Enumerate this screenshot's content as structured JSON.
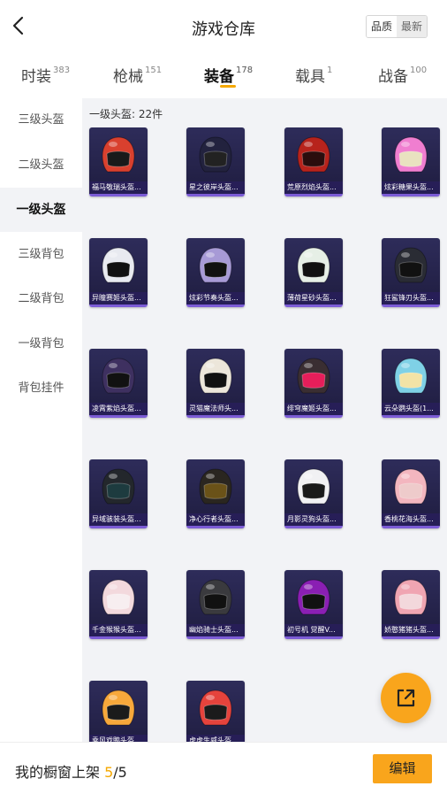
{
  "header": {
    "title": "游戏仓库",
    "sort": {
      "quality": "品质",
      "newest": "最新"
    }
  },
  "tabs": [
    {
      "label": "时装",
      "count": "383"
    },
    {
      "label": "枪械",
      "count": "151"
    },
    {
      "label": "装备",
      "count": "178",
      "active": true
    },
    {
      "label": "载具",
      "count": "1"
    },
    {
      "label": "战备",
      "count": "100"
    }
  ],
  "sidebar": {
    "items": [
      {
        "label": "三级头盔"
      },
      {
        "label": "二级头盔"
      },
      {
        "label": "一级头盔",
        "active": true
      },
      {
        "label": "三级背包"
      },
      {
        "label": "二级背包"
      },
      {
        "label": "一级背包"
      },
      {
        "label": "背包挂件"
      }
    ]
  },
  "content": {
    "count_label": "一级头盔: 22件",
    "items": [
      {
        "label": "福马敬瑞头盔...",
        "color": "#d9402e",
        "visor": "#1a1a1a"
      },
      {
        "label": "星之彼岸头盔...",
        "color": "#22223e",
        "visor": "#222"
      },
      {
        "label": "荒原烈焰头盔...",
        "color": "#b7231c",
        "visor": "#2a0d0d"
      },
      {
        "label": "炫彩糖果头盔...",
        "color": "#f07ed0",
        "visor": "#e9e2c0"
      },
      {
        "label": "异瞳赛姬头盔...",
        "color": "#e8eaf0",
        "visor": "#111"
      },
      {
        "label": "炫彩节奏头盔...",
        "color": "#a79ad6",
        "visor": "#111"
      },
      {
        "label": "薄荷星砂头盔...",
        "color": "#e6efe6",
        "visor": "#111"
      },
      {
        "label": "狂鲨锋刃头盔...",
        "color": "#2a2c34",
        "visor": "#111"
      },
      {
        "label": "凌霄紫焰头盔...",
        "color": "#3e3060",
        "visor": "#111"
      },
      {
        "label": "灵猫魔法师头...",
        "color": "#ece6da",
        "visor": "#111"
      },
      {
        "label": "绯穹魔姬头盔...",
        "color": "#3a2e32",
        "visor": "#e61e5a"
      },
      {
        "label": "云朵鹦头盔(1...",
        "color": "#7fd1e6",
        "visor": "#f3e3a6"
      },
      {
        "label": "异域骇装头盔...",
        "color": "#23272c",
        "visor": "#1d3b3f"
      },
      {
        "label": "净心行者头盔...",
        "color": "#2a2620",
        "visor": "#6a5218"
      },
      {
        "label": "月影灵狗头盔...",
        "color": "#f1f1f3",
        "visor": "#1a1a1a"
      },
      {
        "label": "香桃花海头盔...",
        "color": "#f3b6bf",
        "visor": "#eecbcb"
      },
      {
        "label": "千金猴猴头盔...",
        "color": "#f3d9dd",
        "visor": "#f7eef0"
      },
      {
        "label": "幽焰骑士头盔...",
        "color": "#3a3a3e",
        "visor": "#111"
      },
      {
        "label": "初号机 觉醒V...",
        "color": "#8a1fb3",
        "visor": "#111"
      },
      {
        "label": "娇憨猪猪头盔...",
        "color": "#f0a5b2",
        "visor": "#f3d8dc"
      },
      {
        "label": "乘风戏鸭头盔...",
        "color": "#f7a83b",
        "visor": "#1b1b1b"
      },
      {
        "label": "虎虎生威头盔...",
        "color": "#e5433c",
        "visor": "#1b1b1b"
      }
    ]
  },
  "fab": {
    "icon": "share-external-icon"
  },
  "bottom": {
    "prefix": "我的橱窗上架 ",
    "current": "5",
    "sep": "/",
    "total": "5",
    "edit_label": "编辑"
  },
  "colors": {
    "accent": "#f9a51c",
    "content_bg": "#f2f3f6",
    "card_bg": "#2e2c5a"
  }
}
